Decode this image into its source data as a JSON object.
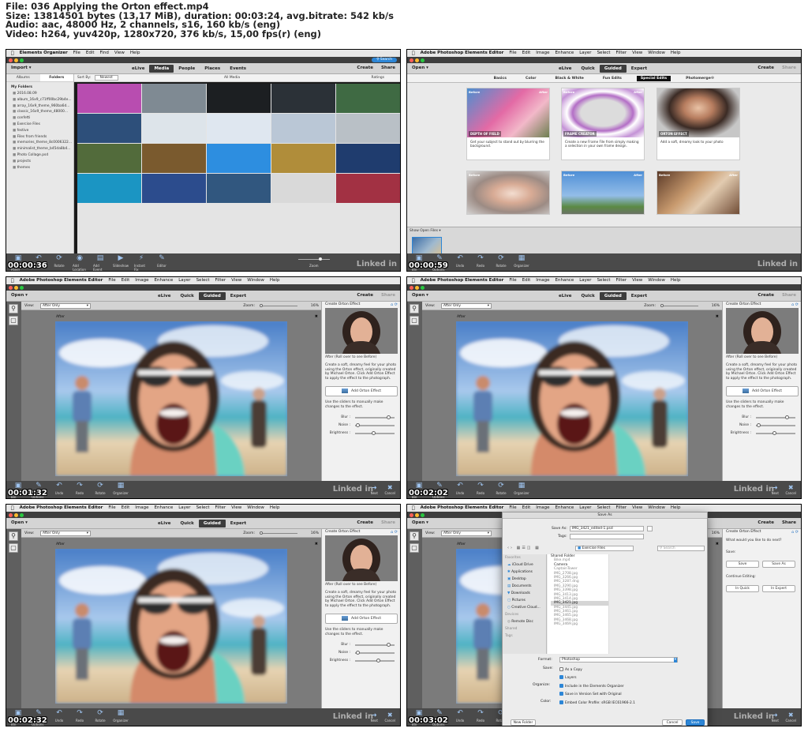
{
  "file_info": {
    "line1": "File: 036 Applying the Orton effect.mp4",
    "line2": "Size: 13814501 bytes (13,17 MiB), duration: 00:03:24, avg.bitrate: 542 kb/s",
    "line3": "Audio: aac, 48000 Hz, 2 channels, s16, 160 kb/s (eng)",
    "line4": "Video: h264, yuv420p, 1280x720, 376 kb/s, 15,00 fps(r) (eng)"
  },
  "timestamps": [
    "00:00:36",
    "00:00:59",
    "00:01:32",
    "00:02:02",
    "00:02:32",
    "00:03:02"
  ],
  "watermark": "Linked in",
  "organizer": {
    "app_name": "Elements Organizer",
    "menu": [
      "File",
      "Edit",
      "Find",
      "View",
      "Help"
    ],
    "search": "Search",
    "import": "Import",
    "tabs": [
      "eLive",
      "Media",
      "People",
      "Places",
      "Events"
    ],
    "create": "Create",
    "share": "Share",
    "albums": "Albums",
    "folders": "Folders",
    "sort_by": "Sort By:",
    "sort_value": "Newest",
    "all_media": "All Media",
    "ratings": "Ratings",
    "my_folders": "My Folders",
    "folder_list": [
      "2016.08.09",
      "album_16x9_c71ff00bc29b4e...",
      "array_16x9_theme_960ba6d...",
      "classic_16x9_theme_48000...",
      "confetti",
      "Exercise Files",
      "festive",
      "Files from friends",
      "memories_theme_8c0006322...",
      "minimalist_theme_b45da8b4...",
      "Photo Collage.psd",
      "projects",
      "themes"
    ],
    "bottom": [
      "Hide Panel",
      "Undo",
      "Rotate",
      "Add Location",
      "Add Event",
      "Slideshow",
      "Instant Fix",
      "Editor"
    ],
    "zoom": "Zoom",
    "grid_colors": [
      "#b84db0",
      "#7f8a93",
      "#1c1f22",
      "#2b3137",
      "#3f6a43",
      "#2d4f7a",
      "#dde4ea",
      "#dfe7f0",
      "#bac7d6",
      "#b9c0c6",
      "#526b3b",
      "#7a5a2e",
      "#2d8ee0",
      "#b08d3a",
      "#1f3c6e",
      "#1b95c3",
      "#2c4c8d",
      "#31577f",
      "#d9d9d9",
      "#a23143"
    ]
  },
  "guided": {
    "app_name": "Adobe Photoshop Elements Editor",
    "menu": [
      "File",
      "Edit",
      "Image",
      "Enhance",
      "Layer",
      "Select",
      "Filter",
      "View",
      "Window",
      "Help"
    ],
    "open": "Open",
    "tabs": [
      "eLive",
      "Quick",
      "Guided",
      "Expert"
    ],
    "create": "Create",
    "share": "Share",
    "subtabs": [
      "Basics",
      "Color",
      "Black & White",
      "Fun Edits",
      "Special Edits",
      "Photomerge®"
    ],
    "before": "Before",
    "after": "After",
    "cards": [
      {
        "title": "DEPTH OF FIELD",
        "desc": "Get your subject to stand out by blurring the background."
      },
      {
        "title": "FRAME CREATOR",
        "desc": "Create a new Frame File from simply making a selection in your own frame design."
      },
      {
        "title": "ORTON EFFECT",
        "desc": "Add a soft, dreamy look to your photo"
      }
    ],
    "show_open_files": "Show Open Files",
    "bottom": [
      "Photo Bin",
      "Tool Options",
      "Undo",
      "Redo",
      "Rotate",
      "Organizer"
    ]
  },
  "editor": {
    "view": "View:",
    "view_value": "After Only",
    "zoom": "Zoom:",
    "zoom_value": "16%",
    "after_label": "After",
    "panel_title": "Create Orton Effect",
    "roll": "After (Roll over to see Before)",
    "desc": "Create a soft, dreamy feel for your photo using the Orton effect, originally created by Michael Orton. Click Add Orton Effect to apply the effect to the photograph.",
    "add_button": "Add Orton Effect",
    "sliders_hint": "Use the sliders to manually make changes to the effect.",
    "blur": "Blur :",
    "noise": "Noise :",
    "brightness": "Brightness :",
    "next": "Next",
    "cancel": "Cancel",
    "slider_values": [
      {
        "blur": 0.84,
        "noise": 0.06,
        "brightness": 0.46
      },
      {
        "blur": 0.78,
        "noise": 0.06,
        "brightness": 0.46
      },
      {
        "blur": 0.84,
        "noise": 0.06,
        "brightness": 0.58
      }
    ]
  },
  "save_dialog": {
    "title": "Save As",
    "save_as_label": "Save As:",
    "filename": "IMG_3421_edited-1.psd",
    "tags_label": "Tags:",
    "location": "Exercise Files",
    "search": "Search",
    "favorites": "Favorites",
    "sidebar": [
      "iCloud Drive",
      "Applications",
      "Desktop",
      "Documents",
      "Downloads",
      "Pictures",
      "Creative Cloud..."
    ],
    "devices": "Devices",
    "remote": "Remote Disc",
    "shared": "Shared",
    "tags_section": "Tags",
    "shared_folder": "Shared Folder",
    "files": [
      "Bike.mp4",
      "Camera",
      "CaptainTower",
      "IMG_2708.jpg",
      "IMG_3266.jpg",
      "IMG_3287.dng",
      "IMG_3290.jpg",
      "IMG_3398.jpg",
      "IMG_3413.jpg",
      "IMG_3414.jpg",
      "IMG_3421.jpg",
      "IMG_3445.jpg",
      "IMG_3461.jpg",
      "IMG_3465.jpg",
      "IMG_3468.jpg",
      "IMG_3469.jpg"
    ],
    "format_label": "Format:",
    "format": "Photoshop",
    "save_label": "Save:",
    "as_copy": "As a Copy",
    "layers": "Layers",
    "organize_label": "Organize:",
    "include": "Include in the Elements Organizer",
    "version_set": "Save in Version Set with Original",
    "color_label": "Color:",
    "color_profile": "Embed Color Profile: sRGB IEC61966-2.1",
    "new_folder": "New Folder",
    "cancel": "Cancel",
    "save": "Save"
  },
  "next_panel": {
    "question": "What would you like to do next?",
    "save": "Save:",
    "save_btn": "Save",
    "save_as_btn": "Save As",
    "continue": "Continue Editing:",
    "in_quick": "In Quick",
    "in_expert": "In Expert"
  }
}
